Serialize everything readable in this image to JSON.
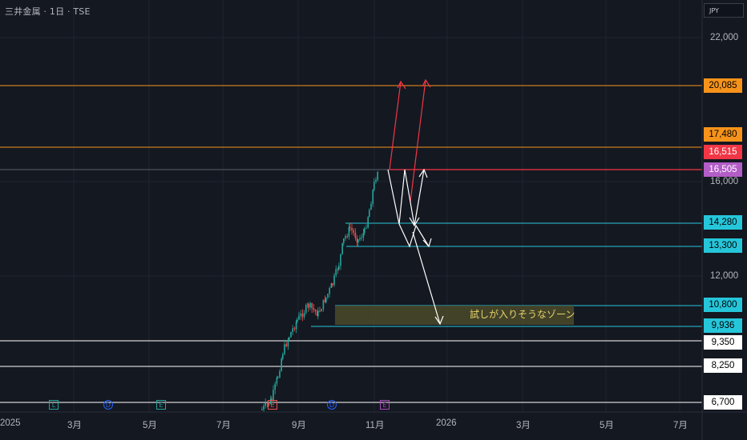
{
  "header": {
    "symbol_title": "三井金属 · 1日 · TSE",
    "currency": "JPY"
  },
  "price_axis_ticks": [
    "22,000",
    "16,000",
    "12,000"
  ],
  "time_axis": [
    "2025",
    "3月",
    "5月",
    "7月",
    "9月",
    "11月",
    "2026",
    "3月",
    "5月",
    "7月"
  ],
  "price_labels": [
    {
      "value": "20,085",
      "style": "orange"
    },
    {
      "value": "17,480",
      "style": "orange"
    },
    {
      "value": "16,515",
      "style": "red"
    },
    {
      "value": "16,505",
      "style": "purple"
    },
    {
      "value": "14,280",
      "style": "cyan"
    },
    {
      "value": "13,300",
      "style": "cyan"
    },
    {
      "value": "10,800",
      "style": "cyan"
    },
    {
      "value": "9,936",
      "style": "cyan"
    },
    {
      "value": "9,350",
      "style": "white"
    },
    {
      "value": "8,250",
      "style": "white"
    },
    {
      "value": "6,700",
      "style": "white"
    }
  ],
  "zone_label": "試しが入りそうなゾーン",
  "event_badges": [
    {
      "glyph": "L",
      "color": "#26a69a"
    },
    {
      "glyph": "D",
      "color": "#2962ff"
    },
    {
      "glyph": "E",
      "color": "#26a69a"
    },
    {
      "glyph": "E",
      "color": "#ef5350"
    },
    {
      "glyph": "D",
      "color": "#2962ff"
    },
    {
      "glyph": "E",
      "color": "#ab47bc"
    }
  ],
  "colors": {
    "background": "#141821",
    "orange": "#f7931a",
    "red": "#f23645",
    "purple": "#b35dc7",
    "cyan": "#26c6da",
    "white": "#ffffff",
    "candle_up": "#26a69a",
    "candle_down": "#ef5350"
  }
}
